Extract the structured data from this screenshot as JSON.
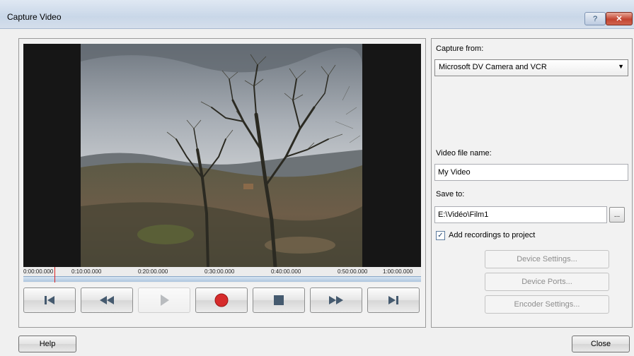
{
  "window": {
    "title": "Capture Video",
    "help_glyph": "?",
    "close_glyph": "✕"
  },
  "timeline": {
    "ticks": [
      "0:00:00.000",
      "0:10:00.000",
      "0:20:00.000",
      "0:30:00.000",
      "0:40:00.000",
      "0:50:00.000",
      "1:00:00.000"
    ]
  },
  "transport": {
    "buttons": [
      "go-to-start",
      "rewind",
      "play",
      "record",
      "stop",
      "fast-forward",
      "go-to-end"
    ],
    "play_enabled": false,
    "record_color": "#d62b2b"
  },
  "capture": {
    "from_label": "Capture from:",
    "device": "Microsoft DV Camera and VCR",
    "file_name_label": "Video file name:",
    "file_name": "My Video",
    "save_to_label": "Save to:",
    "save_to": "E:\\Vidéo\\Film1",
    "browse_label": "...",
    "add_to_project_label": "Add recordings to project",
    "add_to_project_checked": true,
    "device_settings_label": "Device Settings...",
    "device_ports_label": "Device Ports...",
    "encoder_settings_label": "Encoder Settings..."
  },
  "footer": {
    "help_label": "Help",
    "close_label": "Close"
  }
}
